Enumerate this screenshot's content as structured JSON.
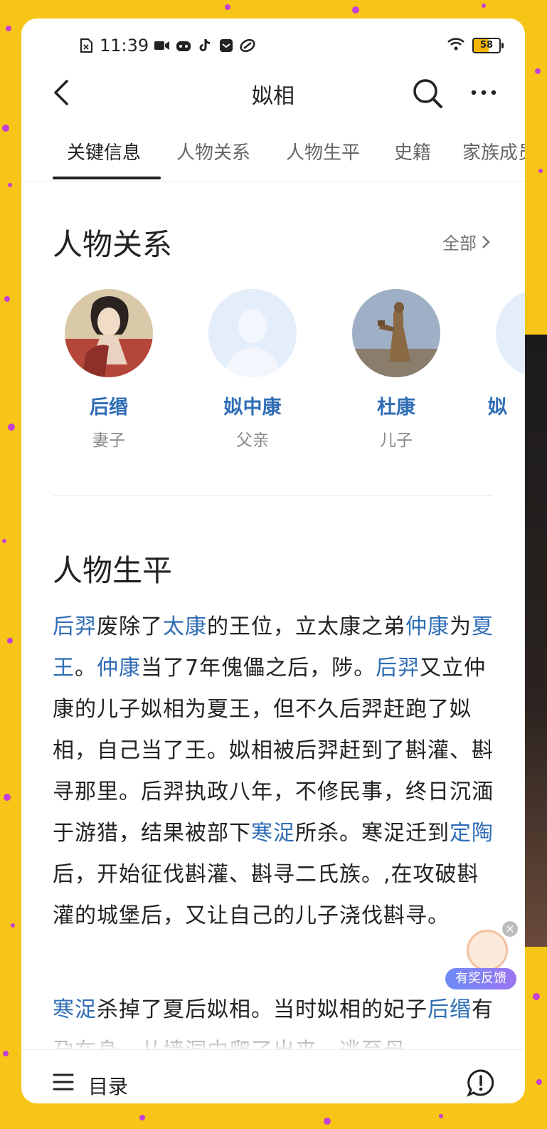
{
  "status_bar": {
    "time": "11:39",
    "battery": "58"
  },
  "header": {
    "title": "姒相"
  },
  "tabs": [
    {
      "label": "关键信息",
      "active": true
    },
    {
      "label": "人物关系",
      "active": false
    },
    {
      "label": "人物生平",
      "active": false
    },
    {
      "label": "史籍",
      "active": false
    },
    {
      "label": "家族成员",
      "active": false
    }
  ],
  "relations_section": {
    "title": "人物关系",
    "see_all": "全部",
    "people": [
      {
        "name": "后缗",
        "role": "妻子"
      },
      {
        "name": "姒中康",
        "role": "父亲"
      },
      {
        "name": "杜康",
        "role": "儿子"
      },
      {
        "name": "姒",
        "role": ""
      }
    ]
  },
  "biography_section": {
    "title": "人物生平",
    "paragraph1": [
      {
        "text": "后羿",
        "link": true
      },
      {
        "text": "废除了",
        "link": false
      },
      {
        "text": "太康",
        "link": true
      },
      {
        "text": "的王位，立太康之弟",
        "link": false
      },
      {
        "text": "仲康",
        "link": true
      },
      {
        "text": "为",
        "link": false
      },
      {
        "text": "夏王",
        "link": true
      },
      {
        "text": "。",
        "link": false
      },
      {
        "text": "仲康",
        "link": true
      },
      {
        "text": "当了7年傀儡之后，陟。",
        "link": false
      },
      {
        "text": "后羿",
        "link": true
      },
      {
        "text": "又立仲康的儿子姒相为夏王，但不久后羿赶跑了姒相，自己当了王。姒相被后羿赶到了斟灌、斟寻那里。后羿执政八年，不修民事，终日沉湎于游猎，结果被部下",
        "link": false
      },
      {
        "text": "寒浞",
        "link": true
      },
      {
        "text": "所杀。寒浞迁到",
        "link": false
      },
      {
        "text": "定陶",
        "link": true
      },
      {
        "text": "后，开始征伐斟灌、斟寻二氏族。,在攻破斟灌的城堡后，又让自己的儿子浇伐斟寻。",
        "link": false
      }
    ],
    "paragraph2": [
      {
        "text": "寒浞",
        "link": true
      },
      {
        "text": "杀掉了夏后姒相。当时姒相的妃子",
        "link": false
      },
      {
        "text": "后缗",
        "link": true
      },
      {
        "text": "有孕在身，从墙洞中爬了出来，逃至母",
        "link": false
      }
    ]
  },
  "feedback": {
    "label": "有奖反馈"
  },
  "bottom_bar": {
    "toc_label": "目录"
  },
  "colors": {
    "link": "#2f6db5",
    "background": "#f7c518",
    "tab_active": "#222222"
  }
}
